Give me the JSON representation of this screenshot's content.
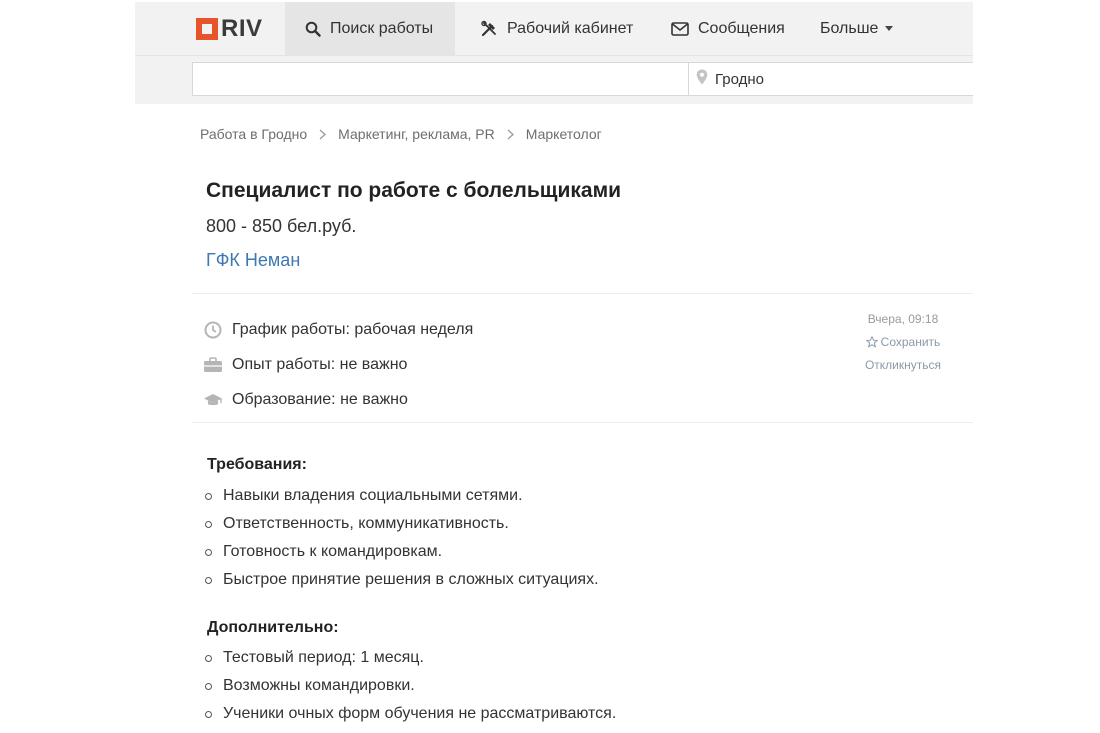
{
  "logo": {
    "text": "RIV",
    "brand_color": "#e8542a"
  },
  "nav": {
    "search_jobs": "Поиск работы",
    "cabinet": "Рабочий кабинет",
    "messages": "Сообщения",
    "more": "Больше"
  },
  "search": {
    "query": "",
    "city": "Гродно"
  },
  "breadcrumb": [
    "Работа в Гродно",
    "Маркетинг, реклама, PR",
    "Маркетолог"
  ],
  "job": {
    "title": "Специалист по работе с болельщиками",
    "salary": "800 - 850 бел.руб.",
    "company": "ГФК Неман",
    "company_color": "#3d78b5"
  },
  "attributes": [
    {
      "icon": "clock-icon",
      "text": "График работы: рабочая неделя"
    },
    {
      "icon": "briefcase-icon",
      "text": "Опыт работы: не важно"
    },
    {
      "icon": "graduation-cap-icon",
      "text": "Образование: не важно"
    }
  ],
  "meta": {
    "posted": "Вчера, 09:18",
    "save": "Сохранить",
    "respond": "Откликнуться"
  },
  "requirements": {
    "title": "Требования:",
    "items": [
      "Навыки владения социальными сетями.",
      "Ответственность, коммуникативность.",
      "Готовность к командировкам.",
      "Быстрое принятие решения в сложных ситуациях."
    ]
  },
  "additional": {
    "title": "Дополнительно:",
    "items": [
      "Тестовый период: 1 месяц.",
      "Возможны командировки.",
      "Ученики очных форм обучения не рассматриваются."
    ]
  }
}
